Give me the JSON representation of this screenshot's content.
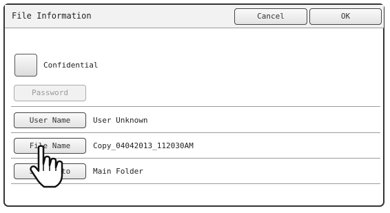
{
  "header": {
    "title": "File Information",
    "cancel_label": "Cancel",
    "ok_label": "OK"
  },
  "confidential": {
    "label": "Confidential"
  },
  "password": {
    "label": "Password"
  },
  "rows": [
    {
      "button_label": "User Name",
      "value": "User Unknown"
    },
    {
      "button_label": "File Name",
      "value": "Copy_04042013_112030AM"
    },
    {
      "button_label": "Stored to",
      "value": "Main Folder"
    }
  ],
  "icons": {
    "pointer": "pointing-hand-icon"
  }
}
